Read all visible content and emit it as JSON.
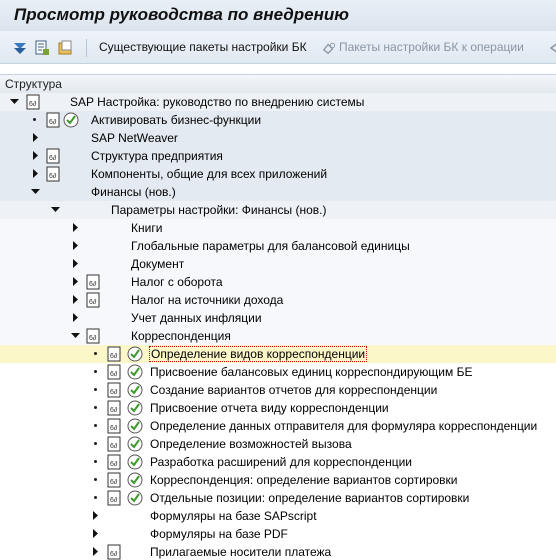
{
  "title": "Просмотр руководства по внедрению",
  "toolbar": {
    "existing_label": "Существующие пакеты настройки БК",
    "operations_label": "Пакеты настройки БК к операции"
  },
  "column_header": "Структура",
  "tree": [
    {
      "label": "SAP Настройка: руководство по внедрению системы"
    },
    {
      "label": "Активировать бизнес-функции"
    },
    {
      "label": "SAP NetWeaver"
    },
    {
      "label": "Структура предприятия"
    },
    {
      "label": "Компоненты, общие для всех приложений"
    },
    {
      "label": "Финансы (нов.)"
    },
    {
      "label": "Параметры настройки: Финансы (нов.)"
    },
    {
      "label": "Книги"
    },
    {
      "label": "Глобальные параметры для балансовой единицы"
    },
    {
      "label": "Документ"
    },
    {
      "label": "Налог с оборота"
    },
    {
      "label": "Налог на источники дохода"
    },
    {
      "label": "Учет данных инфляции"
    },
    {
      "label": "Корреспонденция"
    },
    {
      "label": "Определение видов корреспонденции"
    },
    {
      "label": "Присвоение балансовых единиц корреспондирующим БЕ"
    },
    {
      "label": "Создание вариантов отчетов для корреспонденции"
    },
    {
      "label": "Присвоение отчета виду корреспонденции"
    },
    {
      "label": "Определение данных отправителя для формуляра корреспонденции"
    },
    {
      "label": "Определение возможностей вызова"
    },
    {
      "label": "Разработка расширений для корреспонденции"
    },
    {
      "label": "Корреспонденция: определение вариантов сортировки"
    },
    {
      "label": "Отдельные позиции: определение вариантов сортировки"
    },
    {
      "label": "Формуляры на базе SAPscript"
    },
    {
      "label": "Формуляры на базе PDF"
    },
    {
      "label": "Прилагаемые носители платежа"
    }
  ]
}
